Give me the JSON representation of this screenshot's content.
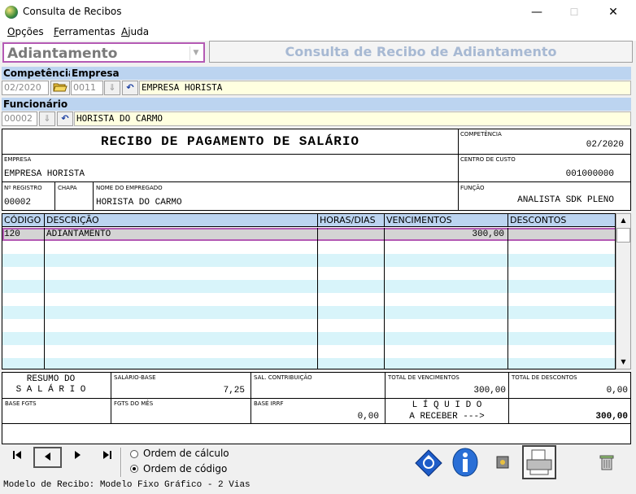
{
  "window": {
    "title": "Consulta de Recibos",
    "min": "—",
    "max": "☐",
    "close": "✕"
  },
  "menu": {
    "items": [
      {
        "first": "O",
        "rest": "pções"
      },
      {
        "first": "F",
        "rest": "erramentas"
      },
      {
        "first": "A",
        "rest": "juda"
      }
    ]
  },
  "type_select": {
    "value": "Adiantamento"
  },
  "header_title": "Consulta de Recibo de Adiantamento",
  "filters": {
    "competencia_label": "Competência",
    "competencia_value": "02/2020",
    "empresa_label": "Empresa",
    "empresa_code": "0011",
    "empresa_name": "EMPRESA HORISTA",
    "funcionario_label": "Funcionário",
    "funcionario_code": "00002",
    "funcionario_name": "HORISTA DO CARMO"
  },
  "receipt": {
    "title": "RECIBO DE PAGAMENTO DE SALÁRIO",
    "competencia_label": "COMPETÊNCIA",
    "competencia": "02/2020",
    "empresa_label": "EMPRESA",
    "empresa": "EMPRESA HORISTA",
    "centro_label": "CENTRO DE CUSTO",
    "centro": "001000000",
    "registro_label": "Nº REGISTRO",
    "registro": "00002",
    "chapa_label": "CHAPA",
    "chapa": "",
    "nome_label": "NOME DO EMPREGADO",
    "nome": "HORISTA DO CARMO",
    "funcao_label": "FUNÇÃO",
    "funcao": "ANALISTA SDK PLENO"
  },
  "grid": {
    "columns": [
      "CÓDIGO",
      "DESCRIÇÃO",
      "HORAS/DIAS",
      "VENCIMENTOS",
      "DESCONTOS"
    ],
    "rows": [
      {
        "codigo": "120",
        "descricao": "ADIANTAMENTO",
        "horas": "",
        "vencimentos": "300,00",
        "descontos": ""
      }
    ]
  },
  "summary": {
    "resumo_line1": "RESUMO DO",
    "resumo_line2": "S A L Á R I O",
    "salario_base_label": "SALÁRIO-BASE",
    "salario_base": "7,25",
    "sal_contrib_label": "SAL. CONTRIBUIÇÃO",
    "sal_contrib": "",
    "total_venc_label": "TOTAL DE VENCIMENTOS",
    "total_venc": "300,00",
    "total_desc_label": "TOTAL DE DESCONTOS",
    "total_desc": "0,00",
    "base_fgts_label": "BASE FGTS",
    "base_fgts": "",
    "fgts_mes_label": "FGTS DO MÊS",
    "fgts_mes": "",
    "base_irrf_label": "BASE IRRF",
    "base_irrf": "0,00",
    "liquido_line1": "L Í Q U I D O",
    "liquido_line2": "A RECEBER --->",
    "liquido": "300,00"
  },
  "nav": {
    "order_calc": "Ordem de cálculo",
    "order_code": "Ordem de código",
    "selected": "Ordem de código"
  },
  "status": "Modelo de Recibo: Modelo Fixo Gráfico - 2 Vias"
}
